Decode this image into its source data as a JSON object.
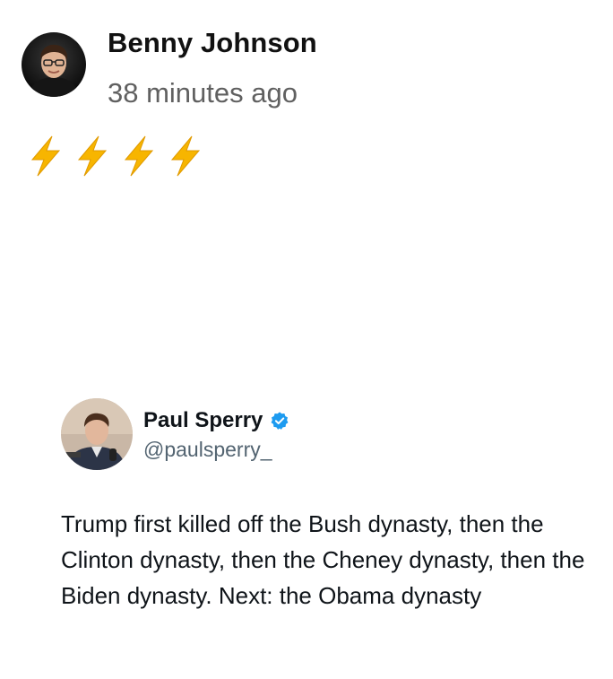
{
  "post": {
    "author_name": "Benny Johnson",
    "timestamp": "38 minutes ago",
    "avatar_icon": "person-avatar",
    "body_icons": [
      "lightning-bolt-icon",
      "lightning-bolt-icon",
      "lightning-bolt-icon",
      "lightning-bolt-icon"
    ]
  },
  "embedded_tweet": {
    "display_name": "Paul Sperry",
    "handle": "@paulsperry_",
    "verified": true,
    "verified_color": "#1d9bf0",
    "avatar_icon": "person-avatar",
    "text": "Trump first killed off the Bush dynasty, then the Clinton dynasty, then the Cheney dynasty, then the Biden dynasty. Next: the Obama dynasty"
  }
}
